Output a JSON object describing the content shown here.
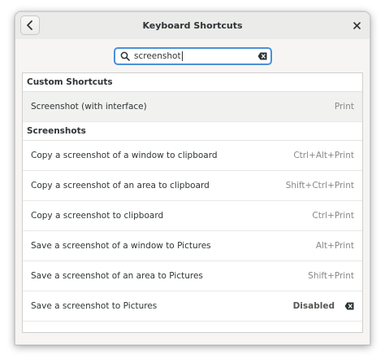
{
  "window": {
    "title": "Keyboard Shortcuts"
  },
  "search": {
    "value": "screenshot"
  },
  "sections": [
    {
      "header": "Custom Shortcuts",
      "rows": [
        {
          "label": "Screenshot (with interface)",
          "accel": "Print"
        }
      ]
    },
    {
      "header": "Screenshots",
      "rows": [
        {
          "label": "Copy a screenshot of a window to clipboard",
          "accel": "Ctrl+Alt+Print"
        },
        {
          "label": "Copy a screenshot of an area to clipboard",
          "accel": "Shift+Ctrl+Print"
        },
        {
          "label": "Copy a screenshot to clipboard",
          "accel": "Ctrl+Print"
        },
        {
          "label": "Save a screenshot of a window to Pictures",
          "accel": "Alt+Print"
        },
        {
          "label": "Save a screenshot of an area to Pictures",
          "accel": "Shift+Print"
        },
        {
          "label": "Save a screenshot to Pictures",
          "accel": "Disabled"
        }
      ]
    }
  ],
  "icons": {
    "back": "chevron-left-icon",
    "close": "close-icon",
    "search": "search-icon",
    "clear": "backspace-clear-icon"
  },
  "colors": {
    "focus": "#4a90d9",
    "text": "#2e3436",
    "accel": "#888a85"
  }
}
